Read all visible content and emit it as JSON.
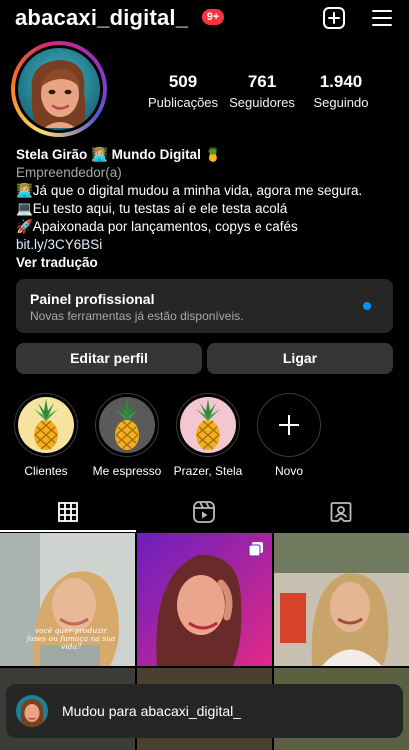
{
  "header": {
    "username": "abacaxi_digital_",
    "notification_badge": "9+",
    "create_icon": "plus-box-icon",
    "menu_icon": "hamburger-menu-icon"
  },
  "stats": [
    {
      "value": "509",
      "label": "Publicações"
    },
    {
      "value": "761",
      "label": "Seguidores"
    },
    {
      "value": "1.940",
      "label": "Seguindo"
    }
  ],
  "bio": {
    "name": "Stela Girão 👩🏼‍💻 Mundo Digital 🍍",
    "category": "Empreendedor(a)",
    "line1": "👩🏼‍💻Já que o digital mudou a minha vida, agora me segura.",
    "line2": "💻Eu testo aqui, tu testas aí e ele testa acolá",
    "line3": "🚀Apaixonada por lançamentos, copys e cafés",
    "link": "bit.ly/3CY6BSi",
    "translate": "Ver tradução"
  },
  "dashboard": {
    "title": "Painel profissional",
    "subtitle": "Novas ferramentas já estão disponíveis."
  },
  "buttons": {
    "edit_profile": "Editar perfil",
    "contact": "Ligar"
  },
  "highlights": [
    {
      "label": "Clientes",
      "bg": "#f6e3a0"
    },
    {
      "label": "Me espresso",
      "bg": "#5a5a5a"
    },
    {
      "label": "Prazer, Stela",
      "bg": "#f4c6cf"
    },
    {
      "label": "Novo"
    }
  ],
  "tabs": [
    "grid-icon",
    "reels-icon",
    "tagged-icon"
  ],
  "posts": [
    {
      "caption": "você quer produzir fases ou fumaça na sua vida?"
    }
  ],
  "toast": {
    "text": "Mudou para abacaxi_digital_"
  },
  "colors": {
    "accent": "#0095f6",
    "badge": "#ff3040",
    "button_bg": "#363636",
    "card_bg": "#262626"
  }
}
